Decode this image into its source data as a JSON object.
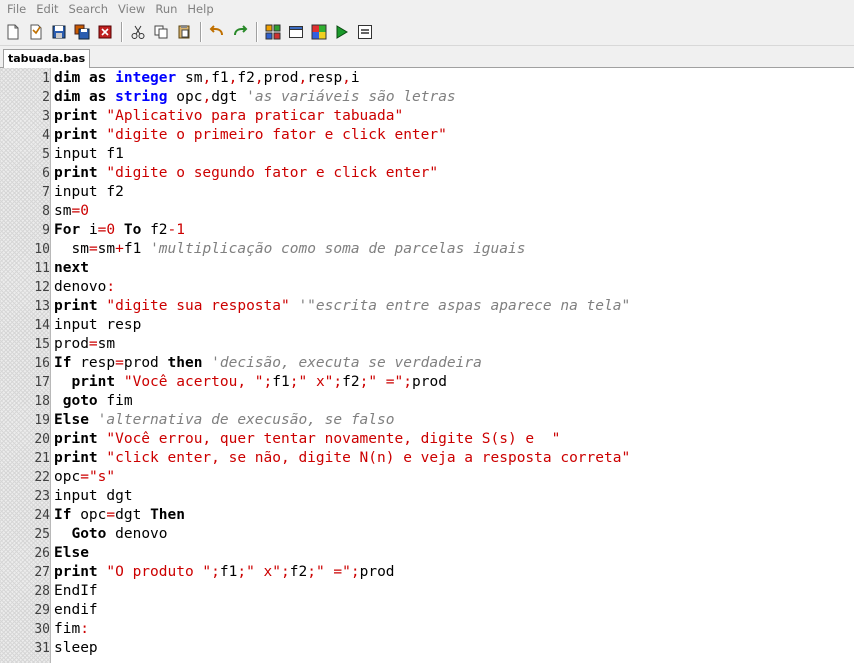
{
  "menu": [
    "File",
    "Edit",
    "Search",
    "View",
    "Run",
    "Help"
  ],
  "toolbar": {
    "groups": [
      [
        "new-file-icon",
        "open-file-icon",
        "save-icon",
        "save-all-icon",
        "close-file-icon"
      ],
      [
        "cut-icon",
        "copy-icon",
        "paste-icon"
      ],
      [
        "undo-icon",
        "redo-icon"
      ],
      [
        "compile-icon",
        "window-icon",
        "color-grid-icon",
        "run-icon",
        "console-icon"
      ]
    ]
  },
  "tab": {
    "label": "tabuada.bas"
  },
  "colors": {
    "keyword": "#000000",
    "type": "#0000ff",
    "string": "#cc0000",
    "comment": "#808080",
    "number": "#cc0000",
    "operator": "#cc0000"
  },
  "editor": {
    "lines": [
      [
        [
          "kw",
          "dim"
        ],
        [
          "ws",
          " "
        ],
        [
          "kw",
          "as"
        ],
        [
          "ws",
          " "
        ],
        [
          "type",
          "integer"
        ],
        [
          "ws",
          " "
        ],
        [
          "id",
          "sm"
        ],
        [
          "op",
          ","
        ],
        [
          "id",
          "f1"
        ],
        [
          "op",
          ","
        ],
        [
          "id",
          "f2"
        ],
        [
          "op",
          ","
        ],
        [
          "id",
          "prod"
        ],
        [
          "op",
          ","
        ],
        [
          "id",
          "resp"
        ],
        [
          "op",
          ","
        ],
        [
          "id",
          "i"
        ]
      ],
      [
        [
          "kw",
          "dim"
        ],
        [
          "ws",
          " "
        ],
        [
          "kw",
          "as"
        ],
        [
          "ws",
          " "
        ],
        [
          "type",
          "string"
        ],
        [
          "ws",
          " "
        ],
        [
          "id",
          "opc"
        ],
        [
          "op",
          ","
        ],
        [
          "id",
          "dgt"
        ],
        [
          "ws",
          " "
        ],
        [
          "com",
          "'as variáveis são letras"
        ]
      ],
      [
        [
          "kw",
          "print"
        ],
        [
          "ws",
          " "
        ],
        [
          "str",
          "\"Aplicativo para praticar tabuada\""
        ]
      ],
      [
        [
          "kw",
          "print"
        ],
        [
          "ws",
          " "
        ],
        [
          "str",
          "\"digite o primeiro fator e click enter\""
        ]
      ],
      [
        [
          "id",
          "input"
        ],
        [
          "ws",
          " "
        ],
        [
          "id",
          "f1"
        ]
      ],
      [
        [
          "kw",
          "print"
        ],
        [
          "ws",
          " "
        ],
        [
          "str",
          "\"digite o segundo fator e click enter\""
        ]
      ],
      [
        [
          "id",
          "input"
        ],
        [
          "ws",
          " "
        ],
        [
          "id",
          "f2"
        ]
      ],
      [
        [
          "id",
          "sm"
        ],
        [
          "op",
          "="
        ],
        [
          "num",
          "0"
        ]
      ],
      [
        [
          "kw",
          "For"
        ],
        [
          "ws",
          " "
        ],
        [
          "id",
          "i"
        ],
        [
          "op",
          "="
        ],
        [
          "num",
          "0"
        ],
        [
          "ws",
          " "
        ],
        [
          "kw",
          "To"
        ],
        [
          "ws",
          " "
        ],
        [
          "id",
          "f2"
        ],
        [
          "op",
          "-"
        ],
        [
          "num",
          "1"
        ]
      ],
      [
        [
          "ws",
          "  "
        ],
        [
          "id",
          "sm"
        ],
        [
          "op",
          "="
        ],
        [
          "id",
          "sm"
        ],
        [
          "op",
          "+"
        ],
        [
          "id",
          "f1"
        ],
        [
          "ws",
          " "
        ],
        [
          "com",
          "'multiplicação como soma de parcelas iguais"
        ]
      ],
      [
        [
          "kw",
          "next"
        ]
      ],
      [
        [
          "id",
          "denovo"
        ],
        [
          "op",
          ":"
        ]
      ],
      [
        [
          "kw",
          "print"
        ],
        [
          "ws",
          " "
        ],
        [
          "str",
          "\"digite sua resposta\""
        ],
        [
          "ws",
          " "
        ],
        [
          "com",
          "'\"escrita entre aspas aparece na tela\""
        ]
      ],
      [
        [
          "id",
          "input"
        ],
        [
          "ws",
          " "
        ],
        [
          "id",
          "resp"
        ]
      ],
      [
        [
          "id",
          "prod"
        ],
        [
          "op",
          "="
        ],
        [
          "id",
          "sm"
        ]
      ],
      [
        [
          "kw",
          "If"
        ],
        [
          "ws",
          " "
        ],
        [
          "id",
          "resp"
        ],
        [
          "op",
          "="
        ],
        [
          "id",
          "prod"
        ],
        [
          "ws",
          " "
        ],
        [
          "kw",
          "then"
        ],
        [
          "ws",
          " "
        ],
        [
          "com",
          "'decisão, executa se verdadeira"
        ]
      ],
      [
        [
          "ws",
          "  "
        ],
        [
          "kw",
          "print"
        ],
        [
          "ws",
          " "
        ],
        [
          "str",
          "\"Você acertou, \""
        ],
        [
          "op",
          ";"
        ],
        [
          "id",
          "f1"
        ],
        [
          "op",
          ";"
        ],
        [
          "str",
          "\" x\""
        ],
        [
          "op",
          ";"
        ],
        [
          "id",
          "f2"
        ],
        [
          "op",
          ";"
        ],
        [
          "str",
          "\" =\""
        ],
        [
          "op",
          ";"
        ],
        [
          "id",
          "prod"
        ]
      ],
      [
        [
          "ws",
          " "
        ],
        [
          "kw",
          "goto"
        ],
        [
          "ws",
          " "
        ],
        [
          "id",
          "fim"
        ]
      ],
      [
        [
          "kw",
          "Else"
        ],
        [
          "ws",
          " "
        ],
        [
          "com",
          "'alternativa de execusão, se falso"
        ]
      ],
      [
        [
          "kw",
          "print"
        ],
        [
          "ws",
          " "
        ],
        [
          "str",
          "\"Você errou, quer tentar novamente, digite S(s) e  \""
        ]
      ],
      [
        [
          "kw",
          "print"
        ],
        [
          "ws",
          " "
        ],
        [
          "str",
          "\"click enter, se não, digite N(n) e veja a resposta correta\""
        ]
      ],
      [
        [
          "id",
          "opc"
        ],
        [
          "op",
          "="
        ],
        [
          "str",
          "\"s\""
        ]
      ],
      [
        [
          "id",
          "input"
        ],
        [
          "ws",
          " "
        ],
        [
          "id",
          "dgt"
        ]
      ],
      [
        [
          "kw",
          "If"
        ],
        [
          "ws",
          " "
        ],
        [
          "id",
          "opc"
        ],
        [
          "op",
          "="
        ],
        [
          "id",
          "dgt"
        ],
        [
          "ws",
          " "
        ],
        [
          "kw",
          "Then"
        ]
      ],
      [
        [
          "ws",
          "  "
        ],
        [
          "kw",
          "Goto"
        ],
        [
          "ws",
          " "
        ],
        [
          "id",
          "denovo"
        ]
      ],
      [
        [
          "kw",
          "Else"
        ]
      ],
      [
        [
          "kw",
          "print"
        ],
        [
          "ws",
          " "
        ],
        [
          "str",
          "\"O produto \""
        ],
        [
          "op",
          ";"
        ],
        [
          "id",
          "f1"
        ],
        [
          "op",
          ";"
        ],
        [
          "str",
          "\" x\""
        ],
        [
          "op",
          ";"
        ],
        [
          "id",
          "f2"
        ],
        [
          "op",
          ";"
        ],
        [
          "str",
          "\" =\""
        ],
        [
          "op",
          ";"
        ],
        [
          "id",
          "prod"
        ]
      ],
      [
        [
          "id",
          "EndIf"
        ]
      ],
      [
        [
          "id",
          "endif"
        ]
      ],
      [
        [
          "id",
          "fim"
        ],
        [
          "op",
          ":"
        ]
      ],
      [
        [
          "id",
          "sleep"
        ]
      ]
    ]
  }
}
